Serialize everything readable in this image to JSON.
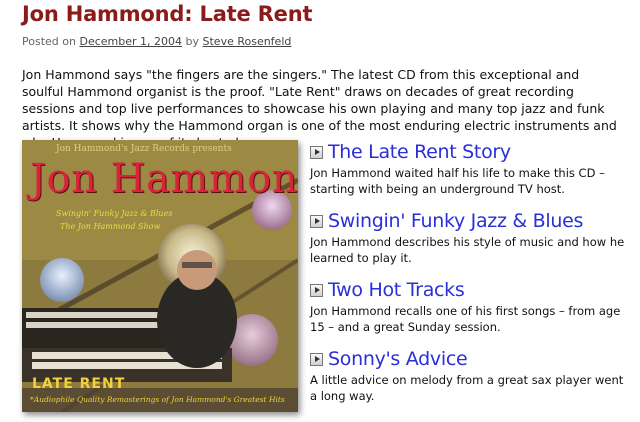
{
  "post": {
    "title": "Jon Hammond: Late Rent",
    "posted_on": "Posted on",
    "date": "December 1, 2004",
    "by": "by",
    "author": "Steve Rosenfeld",
    "intro": "Jon Hammond says \"the fingers are the singers.\" The latest CD from this exceptional and soulful Hammond organist is the proof. \"Late Rent\" draws on decades of great recording sessions and top live performances to showcase his own playing and many top jazz and funk artists. It shows why the Hammond organ is one of the most enduring electric instruments and why Hammond is one of its best players."
  },
  "album": {
    "top_text": "Jon Hammond's Jazz Records presents",
    "name": "Jon Hammond",
    "sub1": "Swingin' Funky Jazz & Blues",
    "sub2": "The Jon Hammond Show",
    "title": "LATE RENT",
    "bottom": "*Audiophile Quality Remasterings of Jon Hammond's Greatest Hits"
  },
  "tracks": [
    {
      "title": "The Late Rent Story",
      "desc": "Jon Hammond waited half his life to make this CD – starting with being an underground TV host."
    },
    {
      "title": "Swingin' Funky Jazz & Blues",
      "desc": "Jon Hammond describes his style of music and how he learned to play it."
    },
    {
      "title": "Two Hot Tracks",
      "desc": "Jon Hammond recalls one of his first songs – from age 15 – and a great Sunday session."
    },
    {
      "title": "Sonny's Advice",
      "desc": "A little advice on melody from a great sax player went a long way."
    }
  ],
  "colors": {
    "title": "#8b1a1a",
    "link": "#2a2fd6"
  }
}
